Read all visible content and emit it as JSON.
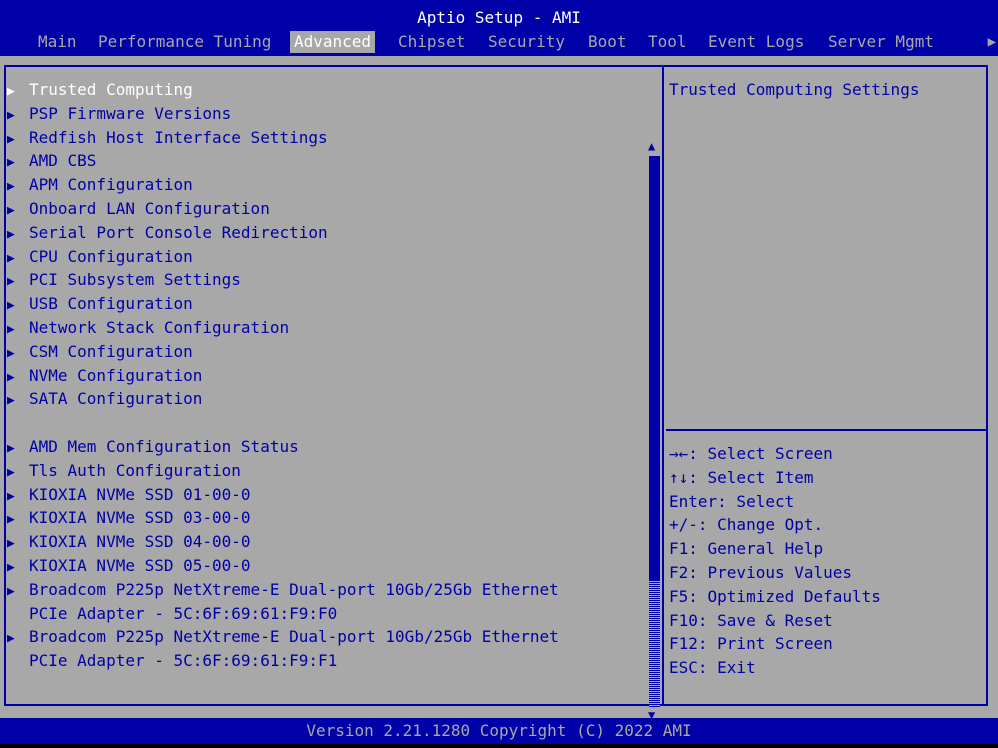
{
  "window": {
    "title": "Aptio Setup - AMI"
  },
  "tabs": [
    {
      "label": "Main"
    },
    {
      "label": "Performance Tuning"
    },
    {
      "label": "Advanced"
    },
    {
      "label": "Chipset"
    },
    {
      "label": "Security"
    },
    {
      "label": "Boot"
    },
    {
      "label": "Tool"
    },
    {
      "label": "Event Logs"
    },
    {
      "label": "Server Mgmt"
    }
  ],
  "tabs_more_icon": "right-arrow-icon",
  "menu": {
    "items": [
      {
        "label": "Trusted Computing"
      },
      {
        "label": "PSP Firmware Versions"
      },
      {
        "label": "Redfish Host Interface Settings"
      },
      {
        "label": "AMD CBS"
      },
      {
        "label": "APM Configuration"
      },
      {
        "label": "Onboard LAN Configuration"
      },
      {
        "label": "Serial Port Console Redirection"
      },
      {
        "label": "CPU Configuration"
      },
      {
        "label": "PCI Subsystem Settings"
      },
      {
        "label": "USB Configuration"
      },
      {
        "label": "Network Stack Configuration"
      },
      {
        "label": "CSM Configuration"
      },
      {
        "label": "NVMe Configuration"
      },
      {
        "label": "SATA Configuration"
      },
      {
        "label": "AMD Mem Configuration Status"
      },
      {
        "label": "Tls Auth Configuration"
      },
      {
        "label": "KIOXIA NVMe SSD 01-00-0"
      },
      {
        "label": "KIOXIA NVMe SSD 03-00-0"
      },
      {
        "label": "KIOXIA NVMe SSD 04-00-0"
      },
      {
        "label": "KIOXIA NVMe SSD 05-00-0"
      },
      {
        "label": "Broadcom P225p NetXtreme-E Dual-port 10Gb/25Gb Ethernet",
        "line2": "PCIe Adapter - 5C:6F:69:61:F9:F0"
      },
      {
        "label": "Broadcom P225p NetXtreme-E Dual-port 10Gb/25Gb Ethernet",
        "line2": "PCIe Adapter - 5C:6F:69:61:F9:F1"
      }
    ],
    "arrow_glyph": "▶",
    "scroll_up_glyph": "▲",
    "scroll_down_glyph": "▼"
  },
  "help": {
    "description": "Trusted Computing Settings",
    "keys": [
      "→←: Select Screen",
      "↑↓: Select Item",
      "Enter: Select",
      "+/-: Change Opt.",
      "F1: General Help",
      "F2: Previous Values",
      "F5: Optimized Defaults",
      "F10: Save & Reset",
      "F12: Print Screen",
      "ESC: Exit"
    ]
  },
  "footer": {
    "text": "Version 2.21.1280 Copyright (C) 2022 AMI"
  },
  "colors": {
    "blue": "#0000a8",
    "gray": "#a8a8a8",
    "white": "#ffffff"
  }
}
